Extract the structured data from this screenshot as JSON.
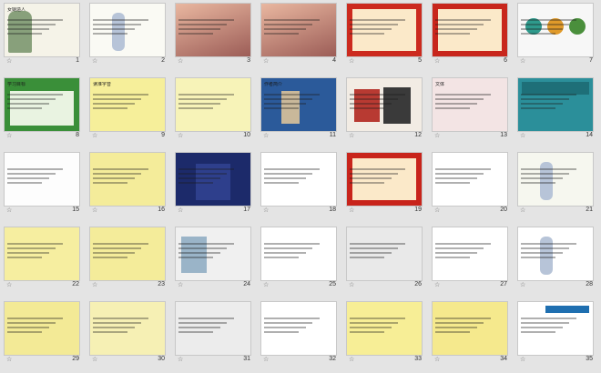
{
  "star_glyph": "☆",
  "slides": [
    {
      "num": "1",
      "style": "cover",
      "title": "女娲造人",
      "bg": "#f5f3e8"
    },
    {
      "num": "2",
      "style": "figure",
      "title": "",
      "bg": "#fafaf4"
    },
    {
      "num": "3",
      "style": "photo",
      "title": "",
      "bg": "#c98b8b"
    },
    {
      "num": "4",
      "style": "photo2",
      "title": "",
      "bg": "#b07b6e"
    },
    {
      "num": "5",
      "style": "red",
      "title": "",
      "bg": "#cc2a1e"
    },
    {
      "num": "6",
      "style": "red2",
      "title": "",
      "bg": "#c8261c"
    },
    {
      "num": "7",
      "style": "circles",
      "title": "",
      "bg": "#f7f7f7"
    },
    {
      "num": "8",
      "style": "green",
      "title": "学习目标",
      "bg": "#3a8f39"
    },
    {
      "num": "9",
      "style": "yellow",
      "title": "读准字音",
      "bg": "#f6ef9a"
    },
    {
      "num": "10",
      "style": "yellow",
      "title": "",
      "bg": "#f7f3b8"
    },
    {
      "num": "11",
      "style": "photo3",
      "title": "作者简介",
      "bg": "#2b5a9a"
    },
    {
      "num": "12",
      "style": "books",
      "title": "",
      "bg": "#f2ece4"
    },
    {
      "num": "13",
      "style": "pink",
      "title": "文体",
      "bg": "#f3e4e4"
    },
    {
      "num": "14",
      "style": "teal",
      "title": "",
      "bg": "#2b8f9a"
    },
    {
      "num": "15",
      "style": "plain",
      "title": "",
      "bg": "#fdfdfd"
    },
    {
      "num": "16",
      "style": "yellow",
      "title": "",
      "bg": "#f4ec9a"
    },
    {
      "num": "17",
      "style": "navy",
      "title": "",
      "bg": "#1c2a6a"
    },
    {
      "num": "18",
      "style": "plain",
      "title": "",
      "bg": "#ffffff"
    },
    {
      "num": "19",
      "style": "red",
      "title": "",
      "bg": "#c8241b"
    },
    {
      "num": "20",
      "style": "plain",
      "title": "",
      "bg": "#ffffff"
    },
    {
      "num": "21",
      "style": "figure2",
      "title": "",
      "bg": "#f6f7ef"
    },
    {
      "num": "22",
      "style": "yellow",
      "title": "",
      "bg": "#f6eea0"
    },
    {
      "num": "23",
      "style": "yellow",
      "title": "",
      "bg": "#f4ec9a"
    },
    {
      "num": "24",
      "style": "photo4",
      "title": "",
      "bg": "#f0f0f0"
    },
    {
      "num": "25",
      "style": "plain",
      "title": "",
      "bg": "#ffffff"
    },
    {
      "num": "26",
      "style": "grey",
      "title": "",
      "bg": "#e9e9e9"
    },
    {
      "num": "27",
      "style": "white",
      "title": "",
      "bg": "#ffffff"
    },
    {
      "num": "28",
      "style": "figure3",
      "title": "",
      "bg": "#ffffff"
    },
    {
      "num": "29",
      "style": "yellow",
      "title": "",
      "bg": "#f3ea96"
    },
    {
      "num": "30",
      "style": "yellow",
      "title": "",
      "bg": "#f6f0b4"
    },
    {
      "num": "31",
      "style": "grey",
      "title": "",
      "bg": "#ececec"
    },
    {
      "num": "32",
      "style": "plain",
      "title": "",
      "bg": "#ffffff"
    },
    {
      "num": "33",
      "style": "yellow",
      "title": "",
      "bg": "#f7ee96"
    },
    {
      "num": "34",
      "style": "yellow",
      "title": "",
      "bg": "#f5e98d"
    },
    {
      "num": "35",
      "style": "ppt",
      "title": "",
      "bg": "#ffffff"
    }
  ]
}
